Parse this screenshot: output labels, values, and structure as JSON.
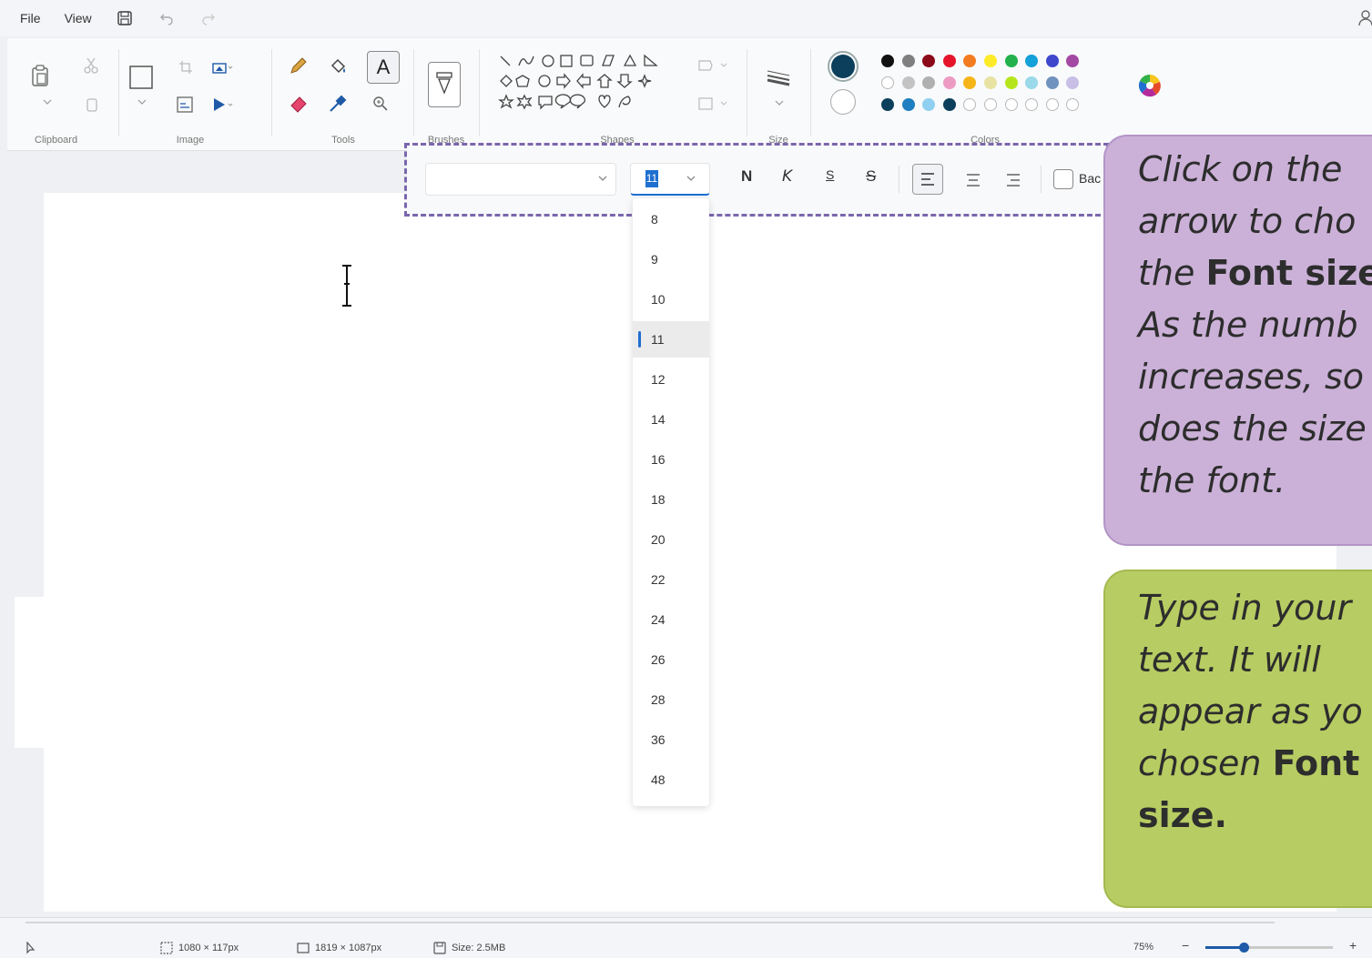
{
  "menu": {
    "file": "File",
    "view": "View"
  },
  "ribbon": {
    "groups": {
      "clipboard": "Clipboard",
      "image": "Image",
      "tools": "Tools",
      "brushes": "Brushes",
      "shapes": "Shapes",
      "size": "Size",
      "colors": "Colors"
    },
    "text_tool_glyph": "A",
    "palette": {
      "current_primary": "#0b3f5c",
      "current_secondary": "#ffffff",
      "row1": [
        "#111111",
        "#7f7f7f",
        "#8b0a1a",
        "#e5142a",
        "#f47c20",
        "#fdeb2a",
        "#22b14c",
        "#14a0d8",
        "#3f48cc",
        "#a349a4"
      ],
      "row2": [
        "",
        "#c3c3c3",
        "#b0b0b0",
        "#ee9bc4",
        "#f5b418",
        "#e8e3a3",
        "#b5e61d",
        "#99d9ea",
        "#7092be",
        "#c8bfe7"
      ],
      "row3": [
        "#0b3f5c",
        "#1e7fc0",
        "#8fd0f0",
        "#0b3f5c",
        "",
        "",
        "",
        "",
        "",
        ""
      ]
    }
  },
  "text_toolbar": {
    "font_family": "",
    "font_size": "11",
    "bold": "N",
    "italic": "K",
    "underline": "S",
    "strikethrough": "S",
    "background_label": "Bac"
  },
  "font_size_dropdown": {
    "options": [
      "8",
      "9",
      "10",
      "11",
      "12",
      "14",
      "16",
      "18",
      "20",
      "22",
      "24",
      "26",
      "28",
      "36",
      "48"
    ],
    "selected": "11"
  },
  "status": {
    "cursor_position": "1080 × 117px",
    "canvas_size": "1819 × 1087px",
    "file_size": "Size: 2.5MB",
    "zoom": "75%",
    "zoom_level": 0.3
  },
  "callouts": {
    "font_size": {
      "line1": "Click on the",
      "line2": "arrow to cho",
      "line3_pre": "the ",
      "line3_bold": "Font size",
      "line4": "As the numb",
      "line5": "increases, so",
      "line6": "does the size",
      "line7": "the font."
    },
    "type_text": {
      "line1": "Type in your",
      "line2": "text. It will",
      "line3": "appear as yo",
      "line4_pre": "chosen ",
      "line4_bold": "Font",
      "line5_bold": "size."
    }
  }
}
